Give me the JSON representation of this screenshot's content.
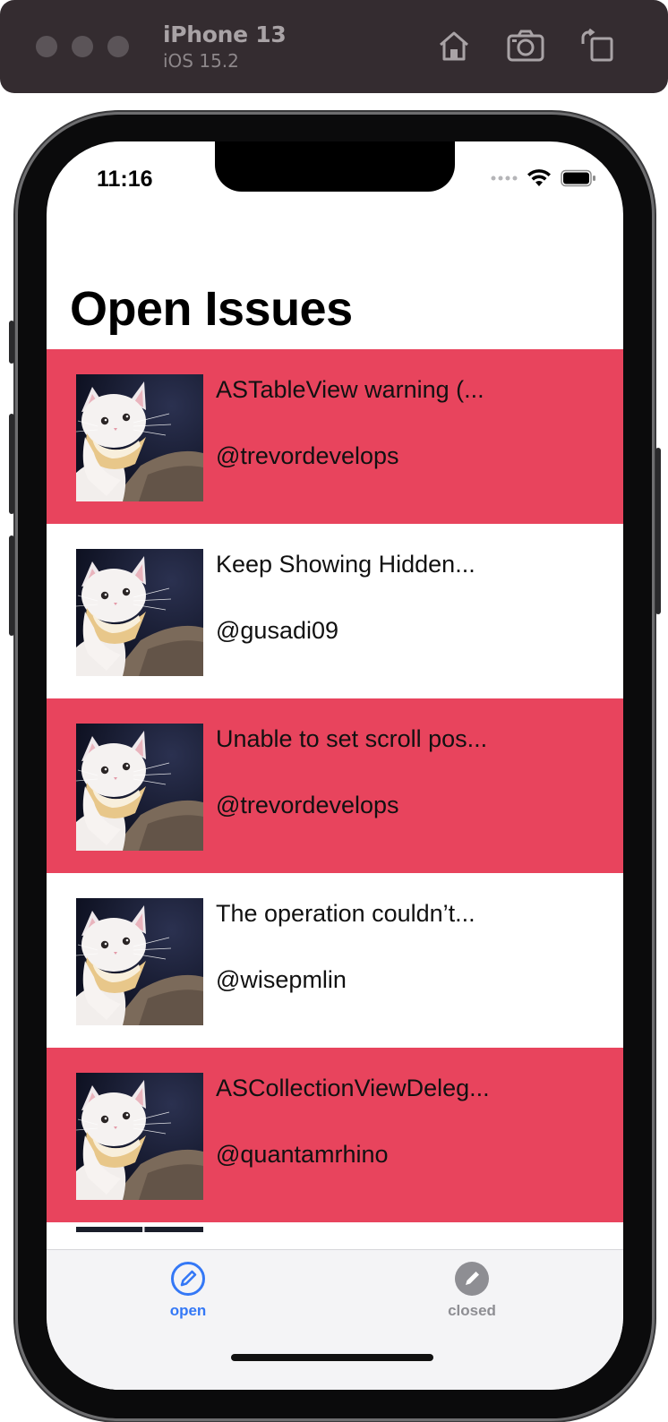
{
  "simulator": {
    "device_name": "iPhone 13",
    "os_version": "iOS 15.2",
    "buttons": [
      "home-icon",
      "screenshot-icon",
      "rotate-icon"
    ]
  },
  "status_bar": {
    "time": "11:16"
  },
  "screen": {
    "title": "Open Issues"
  },
  "issues": [
    {
      "title": "ASTableView warning (...",
      "author": "@trevordevelops",
      "highlight": true
    },
    {
      "title": "Keep Showing Hidden...",
      "author": "@gusadi09",
      "highlight": false
    },
    {
      "title": "Unable to set scroll pos...",
      "author": "@trevordevelops",
      "highlight": true
    },
    {
      "title": "The operation couldn’t...",
      "author": "@wisepmlin",
      "highlight": false
    },
    {
      "title": "ASCollectionViewDeleg...",
      "author": "@quantamrhino",
      "highlight": true
    }
  ],
  "tab_bar": {
    "open_label": "open",
    "closed_label": "closed",
    "selected": "open"
  },
  "colors": {
    "highlight_row": "#e8445d",
    "tab_active": "#3478f6",
    "tab_inactive": "#8e8e93"
  }
}
